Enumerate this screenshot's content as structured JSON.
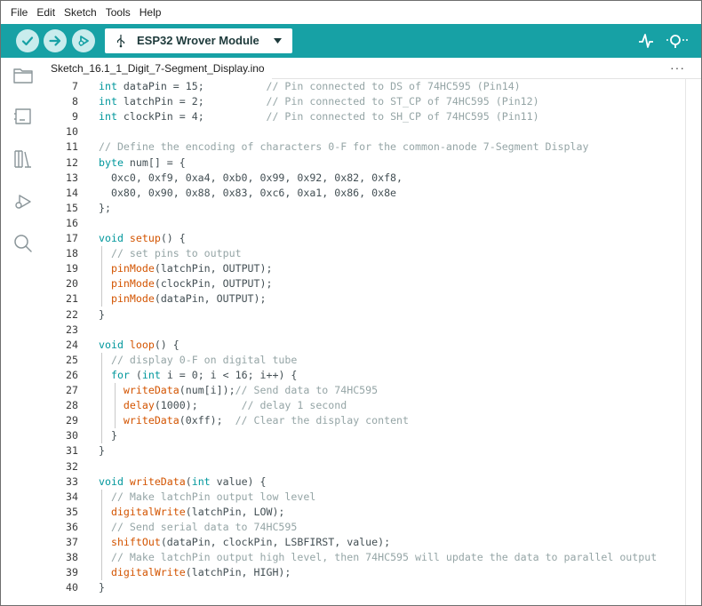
{
  "menu": [
    "File",
    "Edit",
    "Sketch",
    "Tools",
    "Help"
  ],
  "toolbar": {
    "board": "ESP32 Wrover Module",
    "verify_icon": "check-icon",
    "upload_icon": "arrow-right-icon",
    "debug_icon": "debugger-icon",
    "serial_plotter_icon": "serial-plotter-icon",
    "serial_monitor_icon": "serial-monitor-icon"
  },
  "tab": {
    "filename": "Sketch_16.1_1_Digit_7-Segment_Display.ino",
    "more": "···"
  },
  "sidebar_icons": [
    "folder-icon",
    "board-manager-icon",
    "library-icon",
    "debug-icon",
    "search-icon"
  ],
  "colors": {
    "toolbar": "#17a1a5",
    "keyword": "#00979c",
    "function": "#d35400",
    "comment": "#95a5a6"
  },
  "code": [
    {
      "n": "7",
      "tokens": [
        [
          "kw",
          "int"
        ],
        [
          "t",
          " dataPin = 15;          "
        ],
        [
          "cm",
          "// Pin connected to DS of 74HC595 (Pin14)"
        ]
      ]
    },
    {
      "n": "8",
      "tokens": [
        [
          "kw",
          "int"
        ],
        [
          "t",
          " latchPin = 2;          "
        ],
        [
          "cm",
          "// Pin connected to ST_CP of 74HC595 (Pin12)"
        ]
      ]
    },
    {
      "n": "9",
      "tokens": [
        [
          "kw",
          "int"
        ],
        [
          "t",
          " clockPin = 4;          "
        ],
        [
          "cm",
          "// Pin connected to SH_CP of 74HC595 (Pin11)"
        ]
      ]
    },
    {
      "n": "10",
      "tokens": []
    },
    {
      "n": "11",
      "tokens": [
        [
          "cm",
          "// Define the encoding of characters 0-F for the common-anode 7-Segment Display"
        ]
      ]
    },
    {
      "n": "12",
      "tokens": [
        [
          "kw",
          "byte"
        ],
        [
          "t",
          " num[] = {"
        ]
      ]
    },
    {
      "n": "13",
      "tokens": [
        [
          "t",
          "  0xc0, 0xf9, 0xa4, 0xb0, 0x99, 0x92, 0x82, 0xf8,"
        ]
      ]
    },
    {
      "n": "14",
      "tokens": [
        [
          "t",
          "  0x80, 0x90, 0x88, 0x83, 0xc6, 0xa1, 0x86, 0x8e"
        ]
      ]
    },
    {
      "n": "15",
      "tokens": [
        [
          "t",
          "};"
        ]
      ]
    },
    {
      "n": "16",
      "tokens": []
    },
    {
      "n": "17",
      "tokens": [
        [
          "kw",
          "void"
        ],
        [
          "t",
          " "
        ],
        [
          "fn",
          "setup"
        ],
        [
          "t",
          "() {"
        ]
      ]
    },
    {
      "n": "18",
      "tokens": [
        [
          "t",
          "  "
        ],
        [
          "cm",
          "// set pins to output"
        ]
      ]
    },
    {
      "n": "19",
      "tokens": [
        [
          "t",
          "  "
        ],
        [
          "fn",
          "pinMode"
        ],
        [
          "t",
          "(latchPin, OUTPUT);"
        ]
      ]
    },
    {
      "n": "20",
      "tokens": [
        [
          "t",
          "  "
        ],
        [
          "fn",
          "pinMode"
        ],
        [
          "t",
          "(clockPin, OUTPUT);"
        ]
      ]
    },
    {
      "n": "21",
      "tokens": [
        [
          "t",
          "  "
        ],
        [
          "fn",
          "pinMode"
        ],
        [
          "t",
          "(dataPin, OUTPUT);"
        ]
      ]
    },
    {
      "n": "22",
      "tokens": [
        [
          "t",
          "}"
        ]
      ]
    },
    {
      "n": "23",
      "tokens": []
    },
    {
      "n": "24",
      "tokens": [
        [
          "kw",
          "void"
        ],
        [
          "t",
          " "
        ],
        [
          "fn",
          "loop"
        ],
        [
          "t",
          "() {"
        ]
      ]
    },
    {
      "n": "25",
      "tokens": [
        [
          "t",
          "  "
        ],
        [
          "cm",
          "// display 0-F on digital tube"
        ]
      ]
    },
    {
      "n": "26",
      "tokens": [
        [
          "t",
          "  "
        ],
        [
          "kw",
          "for"
        ],
        [
          "t",
          " ("
        ],
        [
          "kw",
          "int"
        ],
        [
          "t",
          " i = 0; i < 16; i++) {"
        ]
      ]
    },
    {
      "n": "27",
      "tokens": [
        [
          "t",
          "    "
        ],
        [
          "fn",
          "writeData"
        ],
        [
          "t",
          "(num[i]);"
        ],
        [
          "cm",
          "// Send data to 74HC595"
        ]
      ]
    },
    {
      "n": "28",
      "tokens": [
        [
          "t",
          "    "
        ],
        [
          "fn",
          "delay"
        ],
        [
          "t",
          "(1000);       "
        ],
        [
          "cm",
          "// delay 1 second"
        ]
      ]
    },
    {
      "n": "29",
      "tokens": [
        [
          "t",
          "    "
        ],
        [
          "fn",
          "writeData"
        ],
        [
          "t",
          "(0xff);  "
        ],
        [
          "cm",
          "// Clear the display content"
        ]
      ]
    },
    {
      "n": "30",
      "tokens": [
        [
          "t",
          "  }"
        ]
      ]
    },
    {
      "n": "31",
      "tokens": [
        [
          "t",
          "}"
        ]
      ]
    },
    {
      "n": "32",
      "tokens": []
    },
    {
      "n": "33",
      "tokens": [
        [
          "kw",
          "void"
        ],
        [
          "t",
          " "
        ],
        [
          "fn",
          "writeData"
        ],
        [
          "t",
          "("
        ],
        [
          "kw",
          "int"
        ],
        [
          "t",
          " value) {"
        ]
      ]
    },
    {
      "n": "34",
      "tokens": [
        [
          "t",
          "  "
        ],
        [
          "cm",
          "// Make latchPin output low level"
        ]
      ]
    },
    {
      "n": "35",
      "tokens": [
        [
          "t",
          "  "
        ],
        [
          "fn",
          "digitalWrite"
        ],
        [
          "t",
          "(latchPin, LOW);"
        ]
      ]
    },
    {
      "n": "36",
      "tokens": [
        [
          "t",
          "  "
        ],
        [
          "cm",
          "// Send serial data to 74HC595"
        ]
      ]
    },
    {
      "n": "37",
      "tokens": [
        [
          "t",
          "  "
        ],
        [
          "fn",
          "shiftOut"
        ],
        [
          "t",
          "(dataPin, clockPin, LSBFIRST, value);"
        ]
      ]
    },
    {
      "n": "38",
      "tokens": [
        [
          "t",
          "  "
        ],
        [
          "cm",
          "// Make latchPin output high level, then 74HC595 will update the data to parallel output"
        ]
      ]
    },
    {
      "n": "39",
      "tokens": [
        [
          "t",
          "  "
        ],
        [
          "fn",
          "digitalWrite"
        ],
        [
          "t",
          "(latchPin, HIGH);"
        ]
      ]
    },
    {
      "n": "40",
      "tokens": [
        [
          "t",
          "}"
        ]
      ]
    }
  ]
}
